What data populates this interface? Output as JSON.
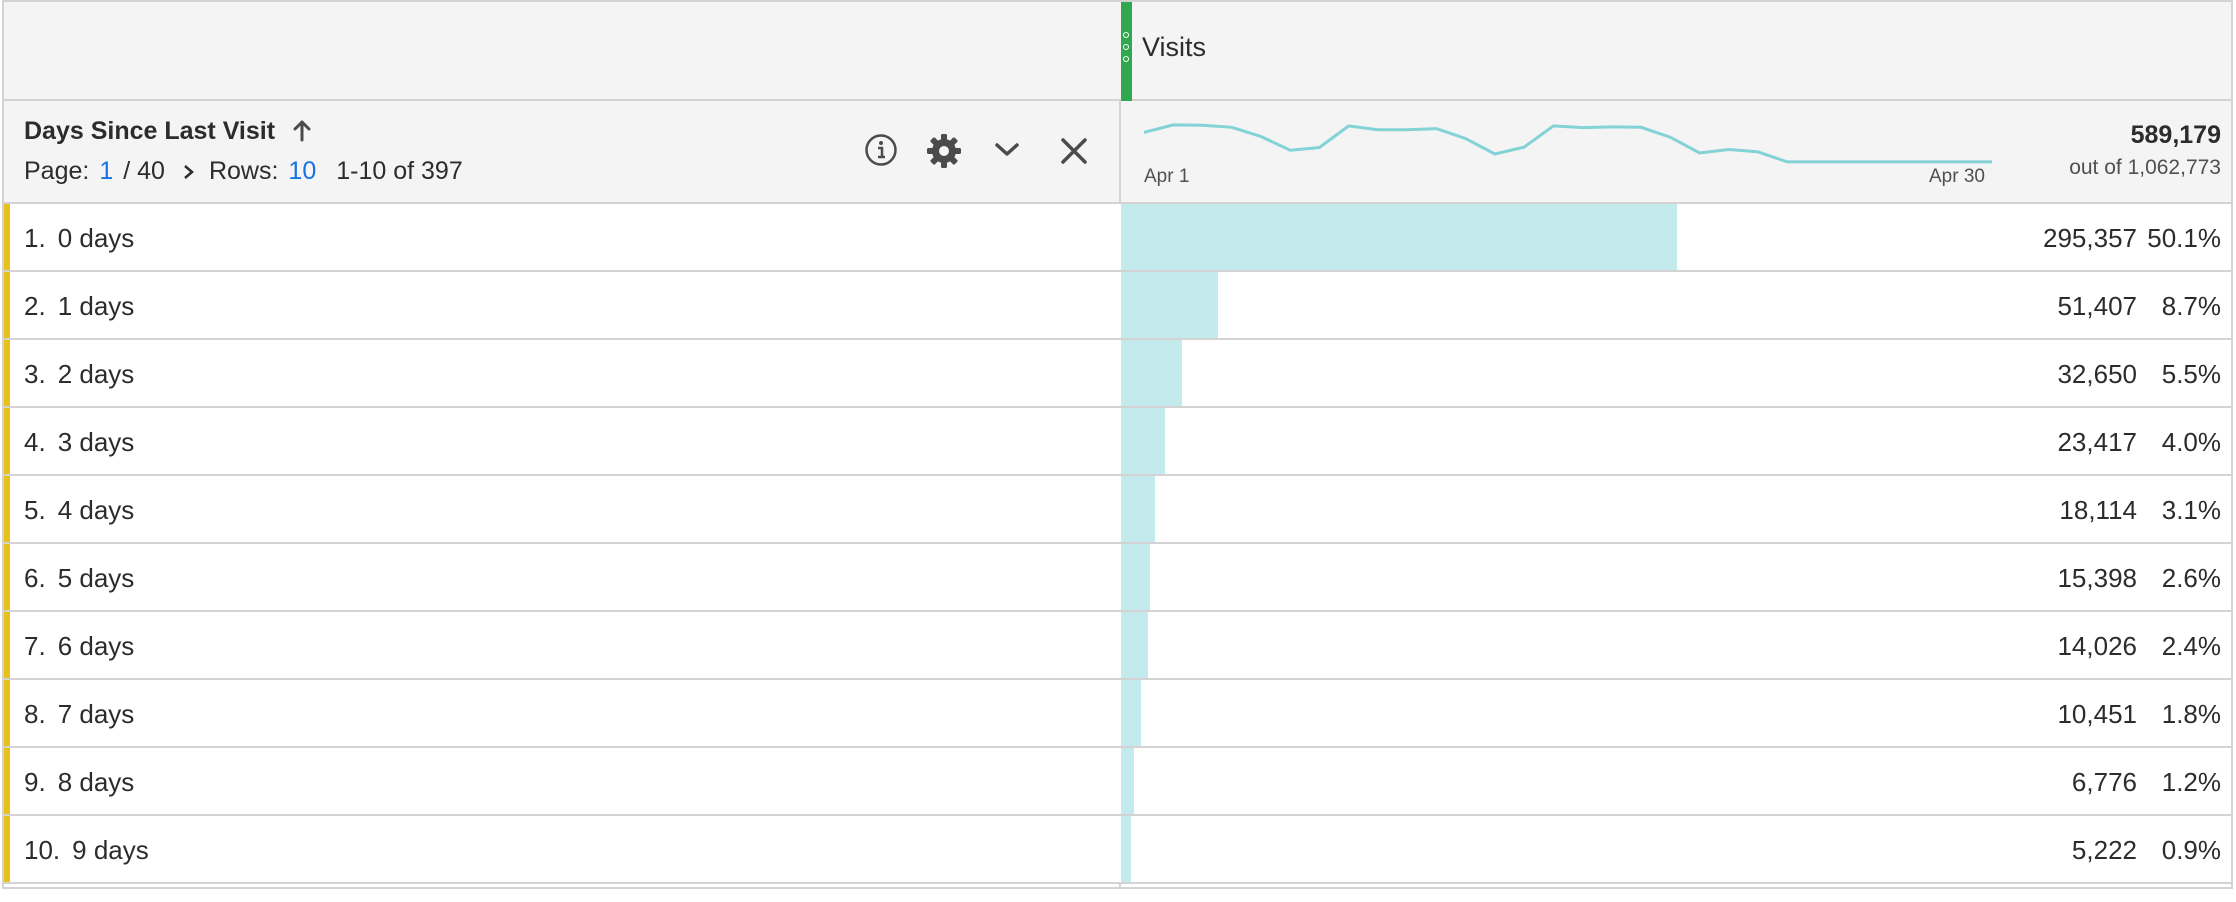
{
  "metric": {
    "title": "Visits",
    "total": "589,179",
    "out_of": "out of 1,062,773",
    "header_color": "#2fa84f"
  },
  "dimension": {
    "title": "Days Since Last Visit",
    "sort_direction": "ascending"
  },
  "pagination": {
    "page_label": "Page:",
    "page": "1",
    "page_total": "/ 40",
    "rows_label": "Rows:",
    "rows": "10",
    "range": "1-10 of 397"
  },
  "sparkline": {
    "start_label": "Apr 1",
    "end_label": "Apr 30",
    "values": [
      0.58,
      0.8,
      0.79,
      0.73,
      0.46,
      0.06,
      0.14,
      0.77,
      0.66,
      0.66,
      0.69,
      0.4,
      -0.05,
      0.15,
      0.77,
      0.72,
      0.74,
      0.73,
      0.44,
      -0.02,
      0.08,
      0.01,
      -0.28,
      -0.28,
      -0.28,
      -0.28,
      -0.28,
      -0.28,
      -0.28,
      -0.28
    ]
  },
  "colors": {
    "bar": "#c3ebed",
    "sparkline": "#82d2d6",
    "row_accent": "#e9c11b",
    "link": "#1473e6"
  },
  "icons": [
    "arrow-up-icon",
    "chevron-right-icon",
    "info-icon",
    "gear-icon",
    "chevron-down-icon",
    "close-icon"
  ],
  "rows": [
    {
      "index": "1.",
      "label": "0 days",
      "value": "295,357",
      "pct": "50.1%",
      "share": 0.501
    },
    {
      "index": "2.",
      "label": "1 days",
      "value": "51,407",
      "pct": "8.7%",
      "share": 0.087
    },
    {
      "index": "3.",
      "label": "2 days",
      "value": "32,650",
      "pct": "5.5%",
      "share": 0.055
    },
    {
      "index": "4.",
      "label": "3 days",
      "value": "23,417",
      "pct": "4.0%",
      "share": 0.04
    },
    {
      "index": "5.",
      "label": "4 days",
      "value": "18,114",
      "pct": "3.1%",
      "share": 0.031
    },
    {
      "index": "6.",
      "label": "5 days",
      "value": "15,398",
      "pct": "2.6%",
      "share": 0.026
    },
    {
      "index": "7.",
      "label": "6 days",
      "value": "14,026",
      "pct": "2.4%",
      "share": 0.024
    },
    {
      "index": "8.",
      "label": "7 days",
      "value": "10,451",
      "pct": "1.8%",
      "share": 0.018
    },
    {
      "index": "9.",
      "label": "8 days",
      "value": "6,776",
      "pct": "1.2%",
      "share": 0.012
    },
    {
      "index": "10.",
      "label": "9 days",
      "value": "5,222",
      "pct": "0.9%",
      "share": 0.009
    }
  ]
}
